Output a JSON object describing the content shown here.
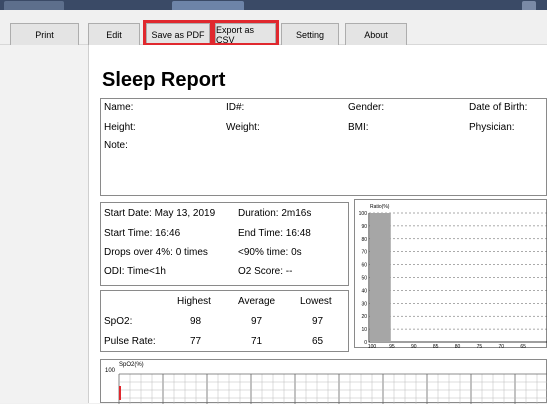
{
  "toolbar": {
    "print": "Print",
    "edit": "Edit",
    "save_pdf": "Save as PDF",
    "export_csv": "Export as CSV",
    "setting": "Setting",
    "about": "About"
  },
  "report": {
    "title": "Sleep Report",
    "patient": {
      "name_label": "Name:",
      "id_label": "ID#:",
      "gender_label": "Gender:",
      "dob_label": "Date of Birth:",
      "height_label": "Height:",
      "weight_label": "Weight:",
      "bmi_label": "BMI:",
      "physician_label": "Physician:",
      "note_label": "Note:"
    },
    "summary": {
      "start_date": "Start Date: May 13, 2019",
      "duration": "Duration: 2m16s",
      "start_time": "Start Time: 16:46",
      "end_time": "End Time: 16:48",
      "drops": "Drops over 4%: 0 times",
      "under90": "<90% time: 0s",
      "odi": "ODI: Time<1h",
      "o2score": "O2 Score: --"
    },
    "stats": {
      "headers": [
        "Highest",
        "Average",
        "Lowest"
      ],
      "rows": [
        {
          "label": "SpO2:",
          "values": [
            "98",
            "97",
            "97"
          ]
        },
        {
          "label": "Pulse Rate:",
          "values": [
            "77",
            "71",
            "65"
          ]
        }
      ]
    },
    "ratio_chart": {
      "ylabel": "Ratio(%)",
      "yticks": [
        "100",
        "90",
        "80",
        "70",
        "60",
        "50",
        "40",
        "30",
        "20",
        "10",
        "0"
      ],
      "xticks": [
        "100",
        "95",
        "90",
        "85",
        "80",
        "75",
        "70",
        "65"
      ]
    },
    "spo2_chart": {
      "ylabel": "SpO2(%)",
      "ytick": "100"
    }
  },
  "chart_data": {
    "type": "bar",
    "ylabel": "Ratio(%)",
    "ylim": [
      0,
      100
    ],
    "categories": [
      "100",
      "95",
      "90",
      "85",
      "80",
      "75",
      "70",
      "65"
    ],
    "values": [
      100,
      0,
      0,
      0,
      0,
      0,
      0,
      0
    ]
  }
}
